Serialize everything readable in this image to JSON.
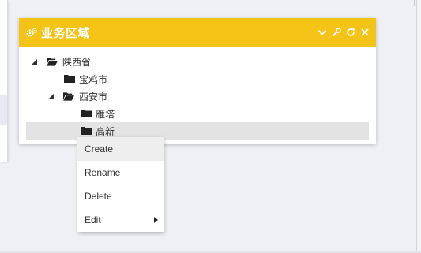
{
  "widget": {
    "title": "业务区域",
    "header_color": "#f3c316",
    "icons": [
      "cogs-icon",
      "chevron-down-icon",
      "wrench-icon",
      "refresh-icon",
      "close-icon"
    ]
  },
  "tree": {
    "root": {
      "label": "陕西省",
      "expanded": true
    },
    "children": [
      {
        "label": "宝鸡市"
      },
      {
        "label": "西安市",
        "expanded": true,
        "children": [
          {
            "label": "雁塔"
          },
          {
            "label": "高新",
            "selected": true
          }
        ]
      }
    ]
  },
  "context_menu": {
    "items": [
      {
        "label": "Create",
        "highlighted": true
      },
      {
        "label": "Rename"
      },
      {
        "label": "Delete"
      },
      {
        "label": "Edit",
        "has_submenu": true
      }
    ]
  }
}
